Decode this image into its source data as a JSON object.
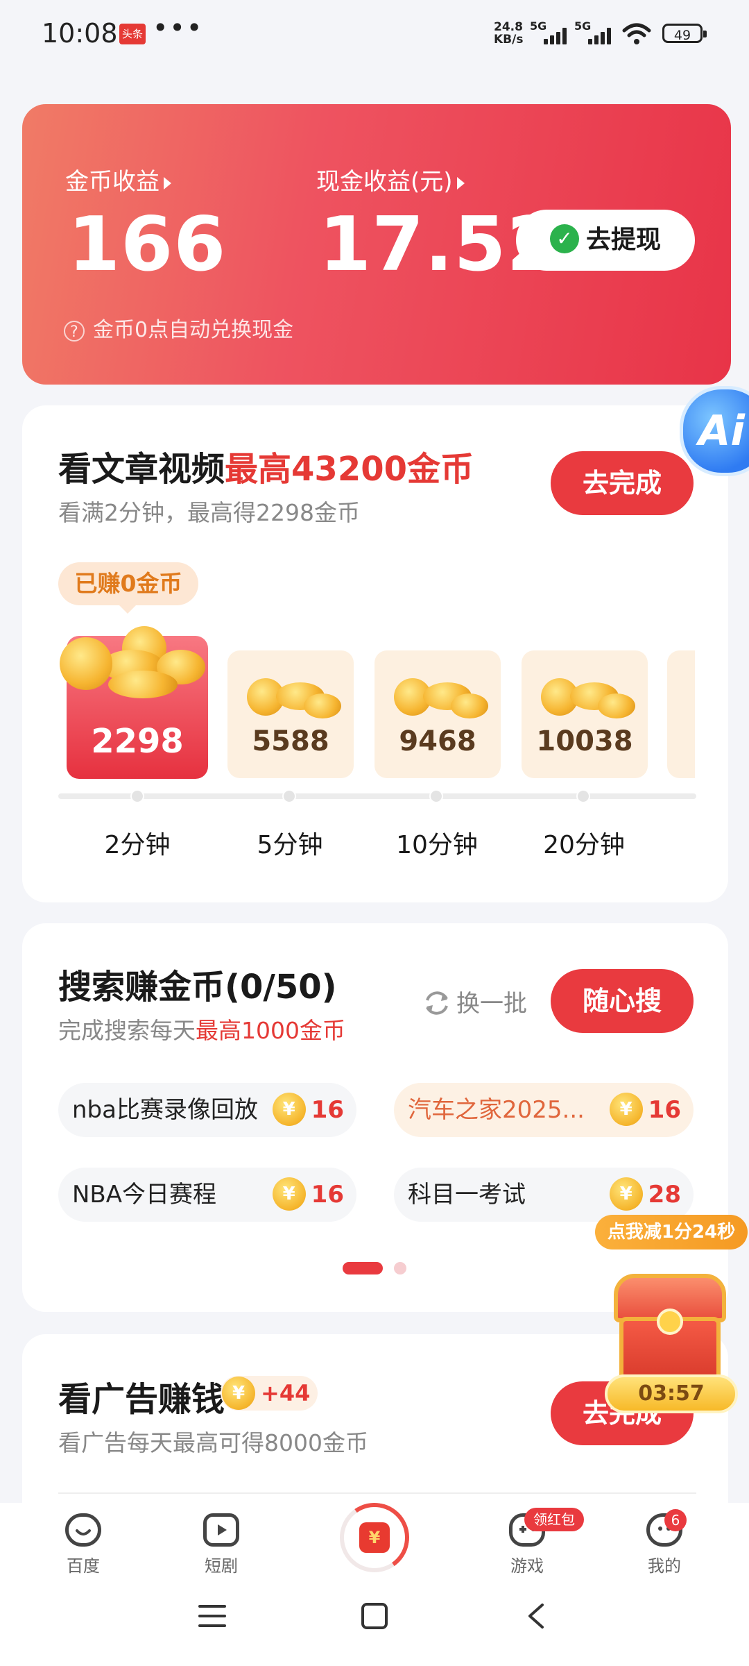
{
  "status_bar": {
    "time": "10:08",
    "app_badge": "头条",
    "more": "•••",
    "net_speed_value": "24.8",
    "net_speed_unit": "KB/s",
    "signal1": "5G",
    "signal2": "5G",
    "battery": "49"
  },
  "earnings": {
    "coin_label": "金币收益",
    "coin_value": "166",
    "cash_label": "现金收益(元)",
    "cash_value": "17.52",
    "withdraw_label": "去提现",
    "hint": "金币0点自动兑换现金"
  },
  "watch_task": {
    "title": "看文章视频",
    "title_highlight": "最高43200金币",
    "subtitle": "看满2分钟，最高得2298金币",
    "button": "去完成",
    "earned_tag": "已赚0金币",
    "rewards": [
      {
        "value": "2298",
        "time": "2分钟"
      },
      {
        "value": "5588",
        "time": "5分钟"
      },
      {
        "value": "9468",
        "time": "10分钟"
      },
      {
        "value": "10038",
        "time": "20分钟"
      }
    ]
  },
  "search_task": {
    "title": "搜索赚金币(0/50)",
    "subtitle_prefix": "完成搜索每天",
    "subtitle_highlight": "最高1000金币",
    "refresh": "换一批",
    "button": "随心搜",
    "chips": [
      {
        "text": "nba比赛录像回放",
        "points": "16"
      },
      {
        "text": "汽车之家2025...",
        "points": "16"
      },
      {
        "text": "NBA今日赛程",
        "points": "16"
      },
      {
        "text": "科目一考试",
        "points": "28"
      }
    ]
  },
  "ad_task": {
    "title": "看广告赚钱",
    "bonus": "+44",
    "subtitle": "看广告每天最高可得8000金币",
    "button": "去完成"
  },
  "floating": {
    "ai": "Ai",
    "bubble": "点我减1分24秒",
    "timer": "03:57"
  },
  "nav": {
    "items": [
      "百度",
      "短剧",
      "游戏",
      "我的"
    ],
    "redpack_badge": "领红包",
    "mine_badge": "6"
  },
  "colors": {
    "accent": "#e93a3f",
    "card_gradient_start": "#f07b66",
    "card_gradient_end": "#e83448",
    "coin": "#f5b52c"
  }
}
